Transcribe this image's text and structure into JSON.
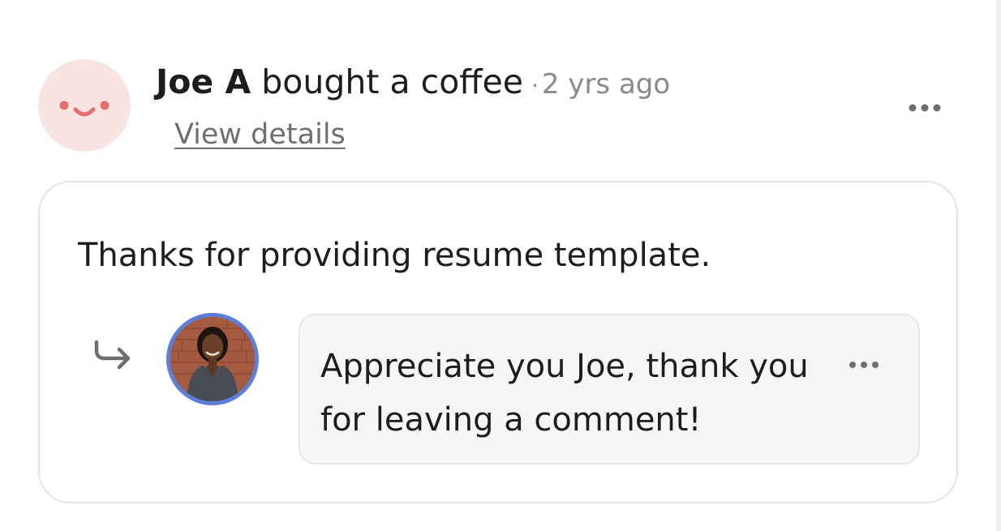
{
  "activity": {
    "user_name": "Joe A",
    "action": "bought a coffee",
    "separator": "·",
    "time_ago": "2 yrs ago",
    "view_details_label": "View details",
    "avatar_icon": "smiley-face-icon",
    "more_icon": "more-options-icon"
  },
  "comment": {
    "text": "Thanks for providing resume template."
  },
  "reply": {
    "arrow_icon": "reply-arrow-icon",
    "avatar_icon": "creator-avatar",
    "text": "Appreciate you Joe, thank you for leaving a comment!",
    "more_icon": "more-options-icon"
  },
  "colors": {
    "avatar_bg": "#f9e3e3",
    "avatar_face": "#e56f6f",
    "reply_avatar_ring": "#5b7fdb",
    "muted_text": "#8a8a8e",
    "bubble_bg": "#f6f6f6",
    "card_border": "#e3e3e5"
  }
}
